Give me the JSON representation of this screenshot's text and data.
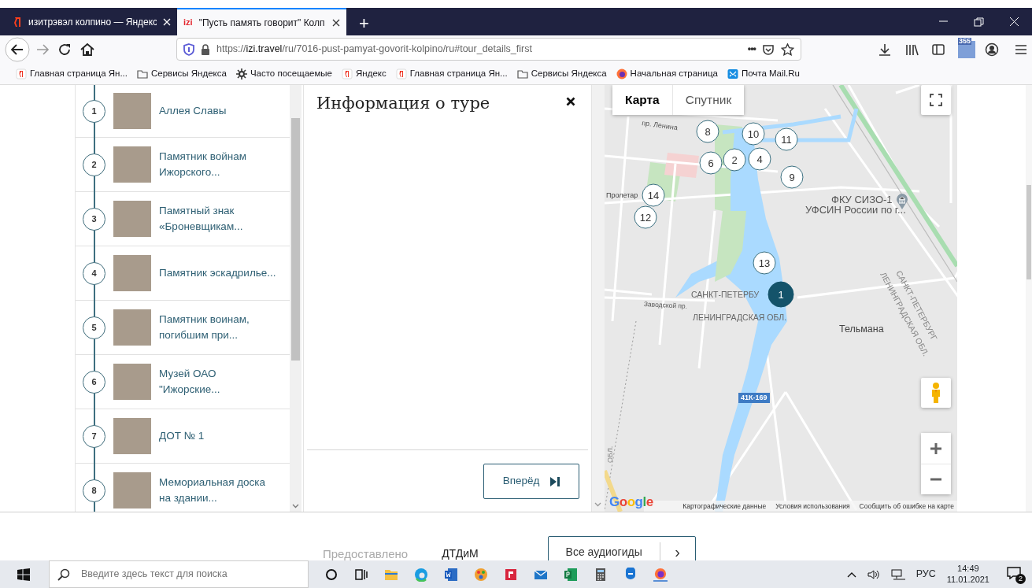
{
  "browser": {
    "tabs": [
      {
        "kind": "yandex",
        "title": "изитрэвэл колпино — Яндекс",
        "selected": false
      },
      {
        "kind": "izi",
        "favicon_text": "izi",
        "title": "\"Пусть память говорит\" Колп",
        "selected": true
      }
    ],
    "new_tab": "+",
    "url": {
      "scheme": "https://",
      "host": "izi.travel",
      "path": "/ru/7016-pust-pamyat-govorit-kolpino/ru#tour_details_first"
    },
    "page_actions": "•••",
    "extension_badge": "355",
    "bookmarks": [
      {
        "kind": "yandex",
        "label": "Главная страница Ян..."
      },
      {
        "kind": "folder",
        "label": "Сервисы Яндекса"
      },
      {
        "kind": "gear",
        "label": "Часто посещаемые"
      },
      {
        "kind": "yandex",
        "label": "Яндекс"
      },
      {
        "kind": "yandex",
        "label": "Главная страница Ян..."
      },
      {
        "kind": "folder",
        "label": "Сервисы Яндекса"
      },
      {
        "kind": "firefox",
        "label": "Начальная страница"
      },
      {
        "kind": "mail",
        "label": "Почта Mail.Ru"
      }
    ]
  },
  "tour_list": {
    "items": [
      {
        "number": "1",
        "title": "Аллея Славы"
      },
      {
        "number": "2",
        "title": "Памятник войнам Ижорского..."
      },
      {
        "number": "3",
        "title": "Памятный знак «Броневщикам..."
      },
      {
        "number": "4",
        "title": "Памятник эскадрилье..."
      },
      {
        "number": "5",
        "title": "Памятник воинам, погибшим при..."
      },
      {
        "number": "6",
        "title": "Музей ОАО \"Ижорские..."
      },
      {
        "number": "7",
        "title": "ДОТ № 1"
      },
      {
        "number": "8",
        "title": "Мемориальная доска на здании..."
      }
    ]
  },
  "info_panel": {
    "title": "Информация о туре",
    "next_button": "Вперёд"
  },
  "map": {
    "type_tabs": [
      {
        "label": "Карта",
        "selected": true
      },
      {
        "label": "Спутник",
        "selected": false
      }
    ],
    "markers": [
      {
        "label": "8",
        "selected": false
      },
      {
        "label": "10",
        "selected": false
      },
      {
        "label": "11",
        "selected": false
      },
      {
        "label": "2",
        "selected": false
      },
      {
        "label": "4",
        "selected": false
      },
      {
        "label": "6",
        "selected": false
      },
      {
        "label": "9",
        "selected": false
      },
      {
        "label": "14",
        "selected": false
      },
      {
        "label": "12",
        "selected": false
      },
      {
        "label": "13",
        "selected": false
      },
      {
        "label": "1",
        "selected": true
      }
    ],
    "labels": [
      {
        "kind": "street",
        "text": "пр. Ленина"
      },
      {
        "kind": "street",
        "text": "Пролетар"
      },
      {
        "kind": "poi",
        "text": "ФКУ СИЗО-1"
      },
      {
        "kind": "poi",
        "text": "УФСИН России по г..."
      },
      {
        "kind": "region",
        "text": "САНКТ-ПЕТЕРБУ"
      },
      {
        "kind": "street",
        "text": "Заводской пр."
      },
      {
        "kind": "region",
        "text": "ЛЕНИНГРАДСКАЯ ОБЛ."
      },
      {
        "kind": "region",
        "text": "САНКТ-ПЕТЕРБУРГ"
      },
      {
        "kind": "region",
        "text": "ЛЕНИНГРАДСКАЯ ОБЛ."
      },
      {
        "kind": "place",
        "text": "Тельмана"
      },
      {
        "kind": "road_number",
        "text": "41К-169"
      },
      {
        "kind": "region",
        "text": "ОБЛ."
      }
    ],
    "logo": "Google",
    "attributions": [
      "Картографические данные",
      "Условия использования",
      "Сообщить об ошибке на карте"
    ]
  },
  "footer": {
    "provided_label": "Предоставлено",
    "provider": "ДТДиМ",
    "all_guides_button": "Все аудиогиды",
    "arrow": "›"
  },
  "taskbar": {
    "search_placeholder": "Введите здесь текст для поиска",
    "language": "РУС",
    "time": "14:49",
    "date": "11.01.2021",
    "notifications": "2"
  }
}
